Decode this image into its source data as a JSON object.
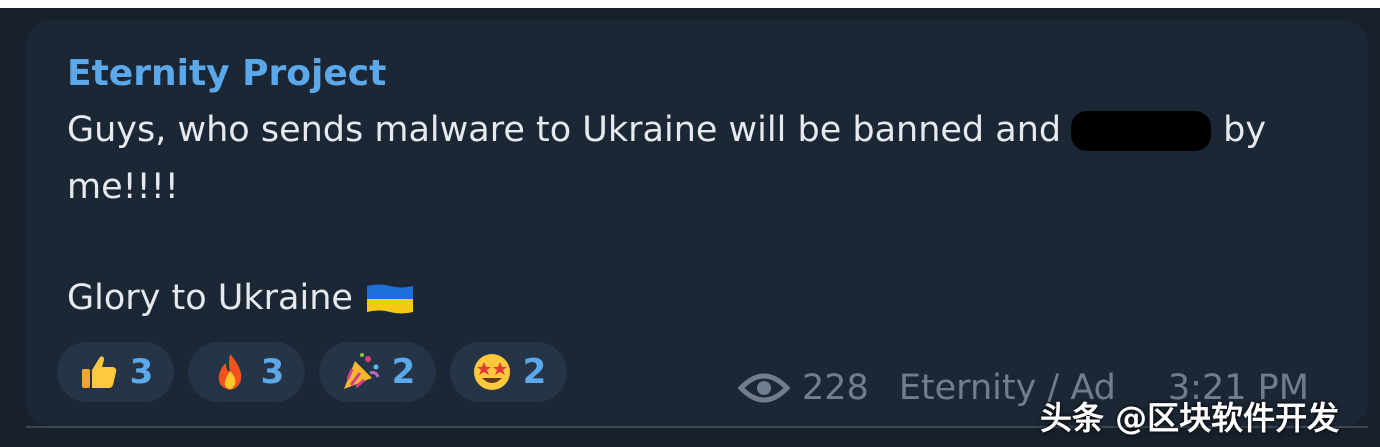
{
  "message": {
    "sender": "Eternity Project",
    "line1_before": "Guys, who sends malware to Ukraine will be banned and",
    "line1_after": "by",
    "line2": "me!!!!",
    "line3": "Glory to Ukraine",
    "flag_icon": "ukraine-flag"
  },
  "reactions": [
    {
      "icon": "thumbs-up",
      "count": "3"
    },
    {
      "icon": "fire",
      "count": "3"
    },
    {
      "icon": "party-popper",
      "count": "2"
    },
    {
      "icon": "star-struck",
      "count": "2"
    }
  ],
  "meta": {
    "views": "228",
    "author": "Eternity / Ad",
    "time": "3:21 PM"
  },
  "watermark": "头条 @区块软件开发",
  "colors": {
    "background": "#17202b",
    "bubble": "#1c2735",
    "accent": "#5ba8ea",
    "text": "#e6e9ed",
    "meta": "#6f7e8f",
    "reaction_pill": "#253447"
  }
}
